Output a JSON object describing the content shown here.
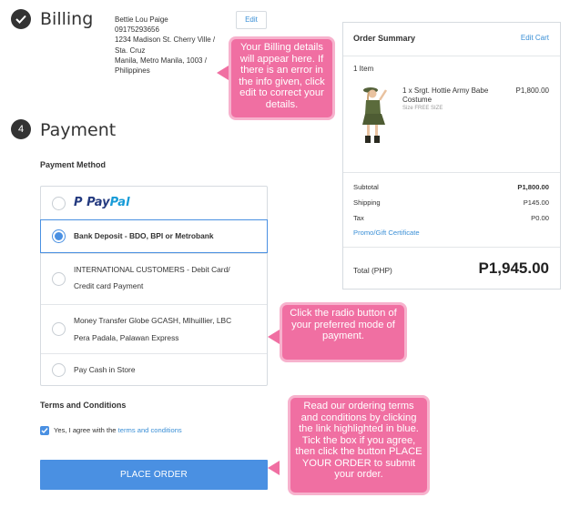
{
  "billing": {
    "title": "Billing",
    "edit_label": "Edit",
    "lines": [
      "Bettie Lou Paige",
      "09175293656",
      "1234 Madison St. Cherry Ville /",
      "Sta. Cruz",
      "Manila, Metro Manila, 1003 /",
      "Philippines"
    ]
  },
  "payment": {
    "step_number": "4",
    "title": "Payment",
    "method_label": "Payment Method",
    "options": [
      {
        "label": "PayPal",
        "logo_part1": "Pay",
        "logo_part2": "Pal",
        "selected": false
      },
      {
        "label": "Bank Deposit - BDO, BPI or Metrobank",
        "selected": true
      },
      {
        "line1": "INTERNATIONAL CUSTOMERS - Debit Card/",
        "line2": "Credit card Payment",
        "selected": false
      },
      {
        "line1": "Money Transfer Globe GCASH, Mlhuillier, LBC",
        "line2": "Pera Padala, Palawan Express",
        "selected": false
      },
      {
        "label": "Pay Cash in Store",
        "selected": false
      }
    ]
  },
  "terms": {
    "title": "Terms and Conditions",
    "agree_prefix": "Yes, I agree with the ",
    "agree_link": "terms and conditions",
    "checked": true
  },
  "place_order_label": "PLACE ORDER",
  "summary": {
    "title": "Order Summary",
    "edit_cart": "Edit Cart",
    "items_count": "1 Item",
    "item": {
      "name": "1 x Srgt. Hottie Army Babe Costume",
      "size": "Size FREE SIZE",
      "price": "P1,800.00"
    },
    "rows": [
      {
        "label": "Subtotal",
        "value": "P1,800.00"
      },
      {
        "label": "Shipping",
        "value": "P145.00"
      },
      {
        "label": "Tax",
        "value": "P0.00"
      }
    ],
    "promo": "Promo/Gift Certificate",
    "total_label": "Total (PHP)",
    "total_value": "P1,945.00"
  },
  "callouts": {
    "billing": "Your Billing details will appear here. If there is an error in the info given, click edit to correct your details.",
    "payment": "Click the radio button of your preferred mode of payment.",
    "terms": "Read our ordering terms and conditions by clicking the link highlighted in blue. Tick the box if you agree, then click the button PLACE YOUR ORDER to submit your order."
  },
  "colors": {
    "accent": "#4a90e2",
    "link": "#3a8fd6",
    "callout": "#f06fa2"
  }
}
